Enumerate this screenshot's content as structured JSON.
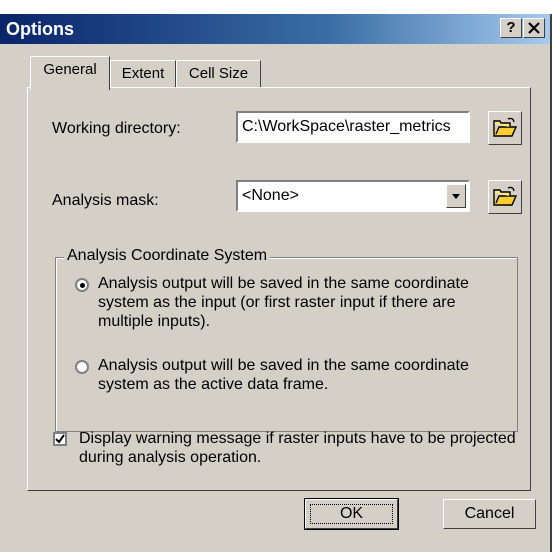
{
  "window": {
    "title": "Options",
    "help_button": "?",
    "close_button": "X"
  },
  "tabs": [
    {
      "label": "General",
      "active": true
    },
    {
      "label": "Extent",
      "active": false
    },
    {
      "label": "Cell Size",
      "active": false
    }
  ],
  "general": {
    "working_directory_label": "Working directory:",
    "working_directory_value": "C:\\WorkSpace\\raster_metrics",
    "analysis_mask_label": "Analysis mask:",
    "analysis_mask_value": "<None>",
    "folder_icon": "open-folder-icon"
  },
  "coordinate_system": {
    "legend": "Analysis Coordinate System",
    "options": [
      {
        "text": "Analysis output will be saved in the same coordinate system as the input (or first raster input if there are multiple inputs).",
        "selected": true
      },
      {
        "text": "Analysis output will be saved in the same coordinate system as the active data frame.",
        "selected": false
      }
    ]
  },
  "warning_checkbox": {
    "text": "Display warning message if raster inputs have to be projected during analysis operation.",
    "checked": true
  },
  "buttons": {
    "ok": "OK",
    "cancel": "Cancel"
  },
  "colors": {
    "titlebar": "#0a246a",
    "face": "#d4d0c8"
  }
}
